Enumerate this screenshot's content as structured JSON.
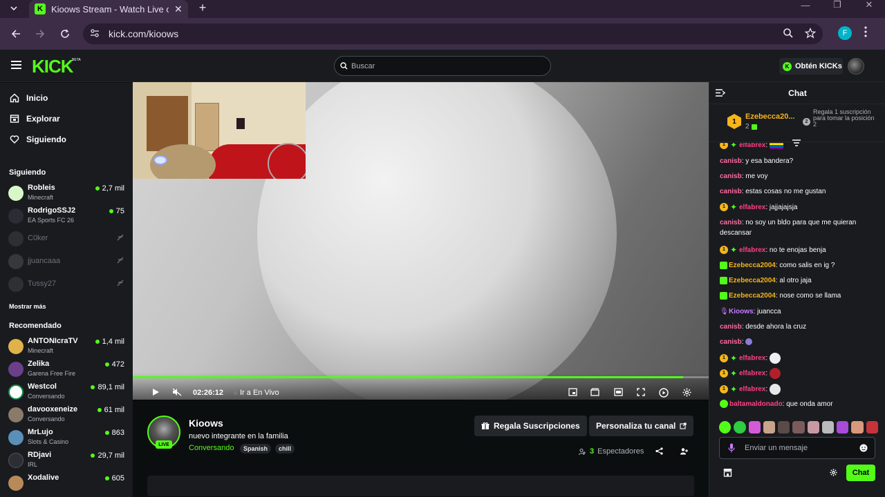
{
  "browser": {
    "tab_title": "Kioows Stream - Watch Live on",
    "favicon_letter": "K",
    "url": "kick.com/kioows",
    "profile_letter": "F"
  },
  "header": {
    "logo": "KICK",
    "beta": "BETA",
    "search_placeholder": "Buscar",
    "kicks_button": "Obtén KICKs"
  },
  "sidebar": {
    "nav": [
      {
        "label": "Inicio",
        "icon": "home-icon"
      },
      {
        "label": "Explorar",
        "icon": "explore-icon"
      },
      {
        "label": "Siguiendo",
        "icon": "heart-icon"
      }
    ],
    "following_title": "Siguiendo",
    "following": [
      {
        "name": "Robleis",
        "category": "Minecraft",
        "viewers": "2,7 mil",
        "online": true
      },
      {
        "name": "RodrigoSSJ2",
        "category": "EA Sports FC 26",
        "viewers": "75",
        "online": true
      },
      {
        "name": "C0ker",
        "online": false
      },
      {
        "name": "jjuancaaa",
        "online": false
      },
      {
        "name": "Tussy27",
        "online": false
      }
    ],
    "show_more": "Mostrar más",
    "recommended_title": "Recomendado",
    "recommended": [
      {
        "name": "ANTONIcraTV",
        "category": "Minecraft",
        "viewers": "1,4 mil"
      },
      {
        "name": "Zelika",
        "category": "Garena Free Fire",
        "viewers": "472"
      },
      {
        "name": "Westcol",
        "category": "Conversando",
        "viewers": "89,1 mil"
      },
      {
        "name": "davooxeneize",
        "category": "Conversando",
        "viewers": "61 mil"
      },
      {
        "name": "MrLujo",
        "category": "Slots & Casino",
        "viewers": "863"
      },
      {
        "name": "RDjavi",
        "category": "IRL",
        "viewers": "29,7 mil"
      },
      {
        "name": "Xodalive",
        "category": "",
        "viewers": "605"
      }
    ]
  },
  "player": {
    "time": "02:26:12",
    "go_live": "Ir a En Vivo",
    "progress_fraction": 0.955
  },
  "stream": {
    "streamer": "Kioows",
    "live_badge": "LIVE",
    "title": "nuevo integrante en la familia",
    "category": "Conversando",
    "tags": [
      "Spanish",
      "chill"
    ],
    "gift_button": "Regala Suscripciones",
    "customize_button": "Personaliza tu canal",
    "viewer_count": "3",
    "viewer_label": "Espectadores"
  },
  "chat": {
    "title": "Chat",
    "pinned": {
      "rank": "1",
      "user": "Ezebecca20...",
      "count": "2",
      "badge2": "2",
      "note": "Regala 1 suscripción para tomar la posición 2"
    },
    "messages": [
      {
        "user": "elfabrex",
        "color": "#ff4081",
        "badges": [
          "rank",
          "spark"
        ],
        "text": "",
        "emote": "flag"
      },
      {
        "user": "canisb",
        "color": "#ff6b9d",
        "badges": [],
        "text": "y esa bandera?"
      },
      {
        "user": "canisb",
        "color": "#ff6b9d",
        "badges": [],
        "text": "me voy"
      },
      {
        "user": "canisb",
        "color": "#ff6b9d",
        "badges": [],
        "text": "estas cosas no me gustan"
      },
      {
        "user": "elfabrex",
        "color": "#ff4081",
        "badges": [
          "rank",
          "spark"
        ],
        "text": "jajjajajsja"
      },
      {
        "user": "canisb",
        "color": "#ff6b9d",
        "badges": [],
        "text": "no soy un bldo para que me quieran descansar"
      },
      {
        "user": "elfabrex",
        "color": "#ff4081",
        "badges": [
          "rank",
          "spark"
        ],
        "text": "no te enojas benja"
      },
      {
        "user": "Ezebecca2004",
        "color": "#f5b51b",
        "badges": [
          "gift"
        ],
        "text": "como salis en ig ?"
      },
      {
        "user": "Ezebecca2004",
        "color": "#f5b51b",
        "badges": [
          "gift"
        ],
        "text": "al otro jaja"
      },
      {
        "user": "Ezebecca2004",
        "color": "#f5b51b",
        "badges": [
          "gift"
        ],
        "text": "nose como se llama"
      },
      {
        "user": "Kioows",
        "color": "#c77dff",
        "badges": [
          "mic"
        ],
        "text": "juancca"
      },
      {
        "user": "canisb",
        "color": "#ff6b9d",
        "badges": [],
        "text": "desde ahora la cruz"
      },
      {
        "user": "canisb",
        "color": "#ff6b9d",
        "badges": [],
        "text": "",
        "emote": "small"
      },
      {
        "user": "elfabrex",
        "color": "#ff4081",
        "badges": [
          "rank",
          "spark"
        ],
        "text": "",
        "emote": "face-white"
      },
      {
        "user": "elfabrex",
        "color": "#ff4081",
        "badges": [
          "rank",
          "spark"
        ],
        "text": "",
        "emote": "face-red"
      },
      {
        "user": "elfabrex",
        "color": "#ff4081",
        "badges": [
          "rank",
          "spark"
        ],
        "text": "",
        "emote": "face-ghost"
      },
      {
        "user": "baltamaldonado",
        "color": "#ff4081",
        "badges": [
          "verified"
        ],
        "text": "que onda amor"
      }
    ],
    "input_placeholder": "Enviar un mensaje",
    "send_button": "Chat"
  },
  "colors": {
    "accent": "#53fc18",
    "background": "#0b0e0f",
    "panel": "#191b1f"
  }
}
